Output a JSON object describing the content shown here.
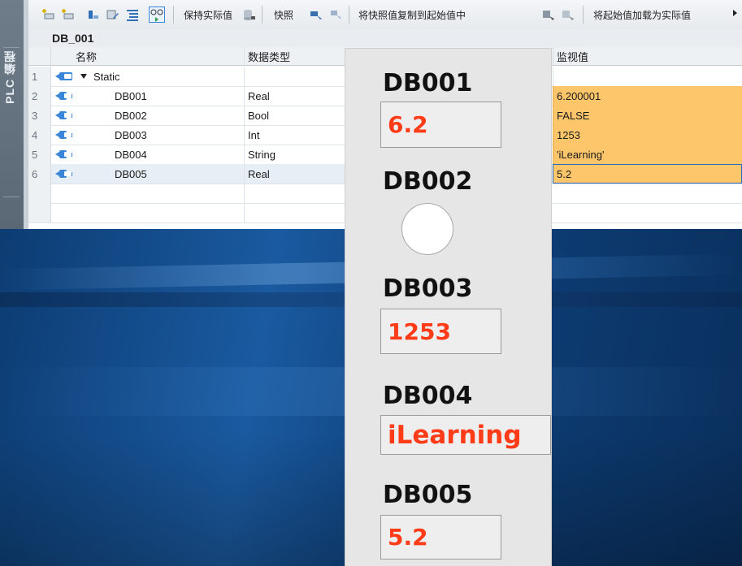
{
  "side_tab": {
    "label": "PLC 编程"
  },
  "toolbar": {
    "keep_actual": "保持实际值",
    "snapshot": "快照",
    "copy_snapshot": "将快照值复制到起始值中",
    "load_start": "将起始值加载为实际值"
  },
  "db_title": "DB_001",
  "table": {
    "headers": {
      "name": "名称",
      "type": "数据类型",
      "monitor": "监视值"
    },
    "rows": [
      {
        "num": "1",
        "name": "Static",
        "type": "",
        "monitor": ""
      },
      {
        "num": "2",
        "name": "DB001",
        "type": "Real",
        "monitor": "6.200001"
      },
      {
        "num": "3",
        "name": "DB002",
        "type": "Bool",
        "monitor": "FALSE"
      },
      {
        "num": "4",
        "name": "DB003",
        "type": "Int",
        "monitor": "1253"
      },
      {
        "num": "5",
        "name": "DB004",
        "type": "String",
        "monitor": "'iLearning'"
      },
      {
        "num": "6",
        "name": "DB005",
        "type": "Real",
        "monitor": "5.2"
      }
    ]
  },
  "hmi": {
    "items": [
      {
        "label": "DB001",
        "value": "6.2"
      },
      {
        "label": "DB002",
        "value": ""
      },
      {
        "label": "DB003",
        "value": "1253"
      },
      {
        "label": "DB004",
        "value": "iLearning"
      },
      {
        "label": "DB005",
        "value": "5.2"
      }
    ],
    "value_color": "#ff3b18"
  }
}
